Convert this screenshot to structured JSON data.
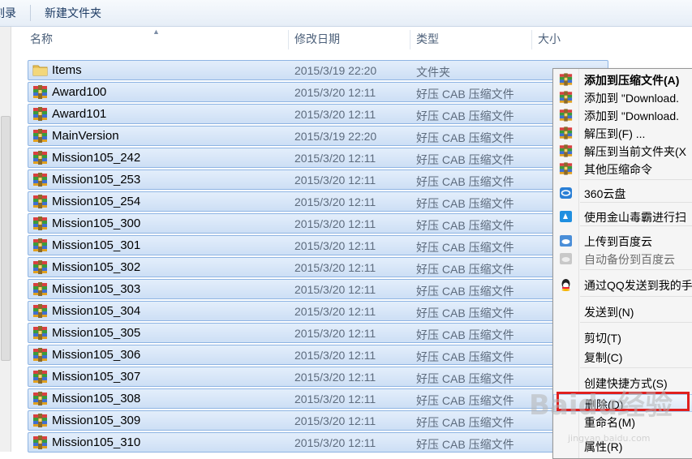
{
  "toolbar": {
    "item0": "刻录",
    "item1": "新建文件夹"
  },
  "columns": {
    "name": "名称",
    "date": "修改日期",
    "type": "类型",
    "size": "大小"
  },
  "files": [
    {
      "name": "Items",
      "date": "2015/3/19 22:20",
      "type": "文件夹",
      "icon": "folder-icon"
    },
    {
      "name": "Award100",
      "date": "2015/3/20 12:11",
      "type": "好压 CAB 压缩文件",
      "icon": "archive-icon"
    },
    {
      "name": "Award101",
      "date": "2015/3/20 12:11",
      "type": "好压 CAB 压缩文件",
      "icon": "archive-icon"
    },
    {
      "name": "MainVersion",
      "date": "2015/3/19 22:20",
      "type": "好压 CAB 压缩文件",
      "icon": "archive-icon"
    },
    {
      "name": "Mission105_242",
      "date": "2015/3/20 12:11",
      "type": "好压 CAB 压缩文件",
      "icon": "archive-icon"
    },
    {
      "name": "Mission105_253",
      "date": "2015/3/20 12:11",
      "type": "好压 CAB 压缩文件",
      "icon": "archive-icon"
    },
    {
      "name": "Mission105_254",
      "date": "2015/3/20 12:11",
      "type": "好压 CAB 压缩文件",
      "icon": "archive-icon"
    },
    {
      "name": "Mission105_300",
      "date": "2015/3/20 12:11",
      "type": "好压 CAB 压缩文件",
      "icon": "archive-icon"
    },
    {
      "name": "Mission105_301",
      "date": "2015/3/20 12:11",
      "type": "好压 CAB 压缩文件",
      "icon": "archive-icon"
    },
    {
      "name": "Mission105_302",
      "date": "2015/3/20 12:11",
      "type": "好压 CAB 压缩文件",
      "icon": "archive-icon"
    },
    {
      "name": "Mission105_303",
      "date": "2015/3/20 12:11",
      "type": "好压 CAB 压缩文件",
      "icon": "archive-icon"
    },
    {
      "name": "Mission105_304",
      "date": "2015/3/20 12:11",
      "type": "好压 CAB 压缩文件",
      "icon": "archive-icon"
    },
    {
      "name": "Mission105_305",
      "date": "2015/3/20 12:11",
      "type": "好压 CAB 压缩文件",
      "icon": "archive-icon"
    },
    {
      "name": "Mission105_306",
      "date": "2015/3/20 12:11",
      "type": "好压 CAB 压缩文件",
      "icon": "archive-icon"
    },
    {
      "name": "Mission105_307",
      "date": "2015/3/20 12:11",
      "type": "好压 CAB 压缩文件",
      "icon": "archive-icon"
    },
    {
      "name": "Mission105_308",
      "date": "2015/3/20 12:11",
      "type": "好压 CAB 压缩文件",
      "icon": "archive-icon"
    },
    {
      "name": "Mission105_309",
      "date": "2015/3/20 12:11",
      "type": "好压 CAB 压缩文件",
      "icon": "archive-icon"
    },
    {
      "name": "Mission105_310",
      "date": "2015/3/20 12:11",
      "type": "好压 CAB 压缩文件",
      "icon": "archive-icon"
    }
  ],
  "context_menu": {
    "items": [
      {
        "label": "添加到压缩文件(A)",
        "icon": "archive-add-icon",
        "bold": true
      },
      {
        "label": "添加到 \"Download.",
        "icon": "archive-add-icon"
      },
      {
        "label": "添加到 \"Download.",
        "icon": "archive-add-icon"
      },
      {
        "label": "解压到(F) ...",
        "icon": "archive-extract-icon"
      },
      {
        "label": "解压到当前文件夹(X",
        "icon": "archive-extract-icon"
      },
      {
        "label": "其他压缩命令",
        "icon": "archive-more-icon"
      },
      {
        "label": "360云盘",
        "icon": "cloud-360-icon"
      },
      {
        "label": "使用金山毒霸进行扫",
        "icon": "antivirus-icon"
      },
      {
        "label": "上传到百度云",
        "icon": "baidu-cloud-icon"
      },
      {
        "label": "自动备份到百度云",
        "icon": "baidu-backup-icon",
        "disabled": true
      },
      {
        "label": "通过QQ发送到我的手",
        "icon": "qq-icon"
      },
      {
        "label": "发送到(N)",
        "icon": ""
      },
      {
        "label": "剪切(T)",
        "icon": ""
      },
      {
        "label": "复制(C)",
        "icon": ""
      },
      {
        "label": "创建快捷方式(S)",
        "icon": ""
      },
      {
        "label": "删除(D)",
        "icon": "",
        "highlighted": true
      },
      {
        "label": "重命名(M)",
        "icon": ""
      },
      {
        "label": "属性(R)",
        "icon": ""
      }
    ]
  },
  "watermark": {
    "text": "Baidu经验",
    "sub": "jingyan.baidu.com"
  },
  "colors": {
    "selection": "#cddff5",
    "highlight_box": "#e0201f"
  }
}
